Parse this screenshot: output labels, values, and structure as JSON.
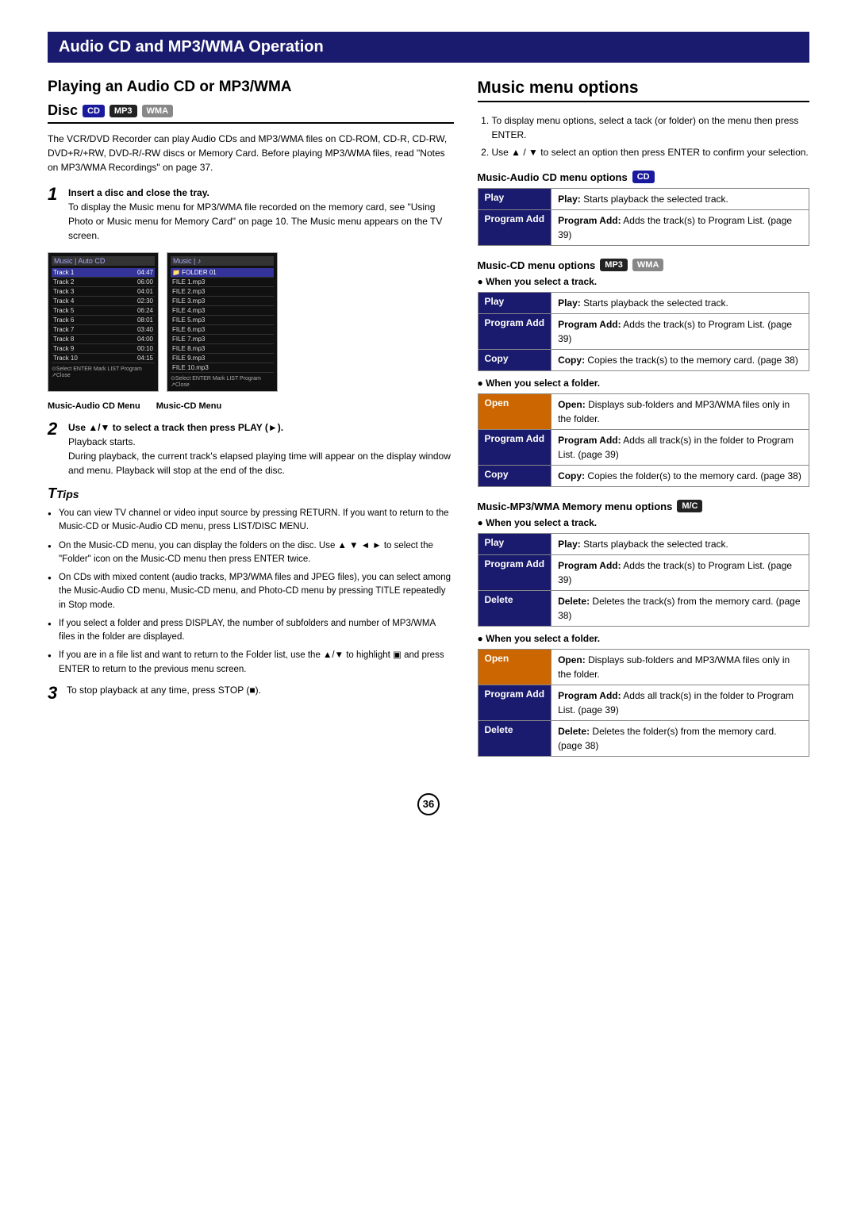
{
  "page": {
    "header": "Audio CD and MP3/WMA Operation",
    "page_number": "36"
  },
  "left": {
    "section_title": "Playing an Audio CD or MP3/WMA",
    "disc_label": "Disc",
    "badges": [
      "CD",
      "MP3",
      "WMA"
    ],
    "intro": "The VCR/DVD Recorder can play Audio CDs and MP3/WMA files on CD-ROM, CD-R, CD-RW, DVD+R/+RW, DVD-R/-RW discs or Memory Card. Before playing MP3/WMA files, read \"Notes on MP3/WMA Recordings\" on page 37.",
    "step1_heading": "Insert a disc and close the tray.",
    "step1_body": "To display the Music menu for MP3/WMA file recorded on the memory card, see \"Using Photo or Music menu for Memory Card\" on page 10. The Music menu appears on the TV screen.",
    "menu_label_left": "Music-Audio CD Menu",
    "menu_label_right": "Music-CD Menu",
    "step2_heading": "Use ▲/▼ to select a track then press PLAY (►).",
    "step2_body": "Playback starts.",
    "step2_detail": "During playback, the current track's elapsed playing time will appear on the display window and menu. Playback will stop at the end of the disc.",
    "tips_header": "Tips",
    "tips": [
      "You can view TV channel or video input source by pressing RETURN. If you want to return to the Music-CD or Music-Audio CD menu, press LIST/DISC MENU.",
      "On the Music-CD menu, you can display the folders on the disc. Use ▲ ▼ ◄ ► to select the \"Folder\" icon on the Music-CD menu then press ENTER twice.",
      "On CDs with mixed content (audio tracks, MP3/WMA files and JPEG files), you can select among the Music-Audio CD menu, Music-CD menu, and Photo-CD menu by pressing TITLE repeatedly in Stop mode.",
      "If you select a folder and press DISPLAY, the number of subfolders and number of MP3/WMA files in the folder are displayed.",
      "If you are in a file list and want to return to the Folder list, use the ▲/▼ to highlight ▣ and press ENTER to return to the previous menu screen."
    ],
    "step3_heading": "To stop playback at any time, press STOP (■)."
  },
  "right": {
    "section_title": "Music menu options",
    "numbered_steps": [
      "To display menu options, select a tack (or folder) on the menu then press ENTER.",
      "Use ▲ / ▼ to select an option then press ENTER to confirm your selection."
    ],
    "sections": [
      {
        "heading": "Music-Audio CD menu options",
        "badge": "CD",
        "badge_color": "blue",
        "sub_sections": [
          {
            "bullet": null,
            "options": [
              {
                "label": "Play",
                "label_color": "blue",
                "desc": "Play: Starts playback the selected track."
              },
              {
                "label": "Program Add",
                "label_color": "blue",
                "desc": "Program Add: Adds the track(s) to Program List. (page 39)"
              }
            ]
          }
        ]
      },
      {
        "heading": "Music-CD menu options",
        "badges": [
          "MP3",
          "WMA"
        ],
        "sub_sections": [
          {
            "bullet": "When you select a track.",
            "options": [
              {
                "label": "Play",
                "label_color": "blue",
                "desc": "Play: Starts playback the selected track."
              },
              {
                "label": "Program Add",
                "label_color": "blue",
                "desc": "Program Add: Adds the track(s) to Program List. (page 39)"
              },
              {
                "label": "Copy",
                "label_color": "blue",
                "desc": "Copy: Copies the track(s) to the memory card. (page 38)"
              }
            ]
          },
          {
            "bullet": "When you select a folder.",
            "options": [
              {
                "label": "Open",
                "label_color": "orange",
                "desc": "Open: Displays sub-folders and MP3/WMA files only in the folder."
              },
              {
                "label": "Program Add",
                "label_color": "blue",
                "desc": "Program Add: Adds all track(s) in the folder to Program List. (page 39)"
              },
              {
                "label": "Copy",
                "label_color": "blue",
                "desc": "Copy: Copies the folder(s) to the memory card. (page 38)"
              }
            ]
          }
        ]
      },
      {
        "heading": "Music-MP3/WMA Memory menu options",
        "badge": "M/C",
        "badge_color": "dark",
        "sub_sections": [
          {
            "bullet": "When you select a track.",
            "options": [
              {
                "label": "Play",
                "label_color": "blue",
                "desc": "Play: Starts playback the selected track."
              },
              {
                "label": "Program Add",
                "label_color": "blue",
                "desc": "Program Add: Adds the track(s) to Program List. (page 39)"
              },
              {
                "label": "Delete",
                "label_color": "blue",
                "desc": "Delete: Deletes the track(s) from the memory card. (page 38)"
              }
            ]
          },
          {
            "bullet": "When you select a folder.",
            "options": [
              {
                "label": "Open",
                "label_color": "orange",
                "desc": "Open: Displays sub-folders and MP3/WMA files only in the folder."
              },
              {
                "label": "Program Add",
                "label_color": "blue",
                "desc": "Program Add: Adds all track(s) in the folder to Program List. (page 39)"
              },
              {
                "label": "Delete",
                "label_color": "blue",
                "desc": "Delete: Deletes the folder(s) from the memory card. (page 38)"
              }
            ]
          }
        ]
      }
    ]
  }
}
